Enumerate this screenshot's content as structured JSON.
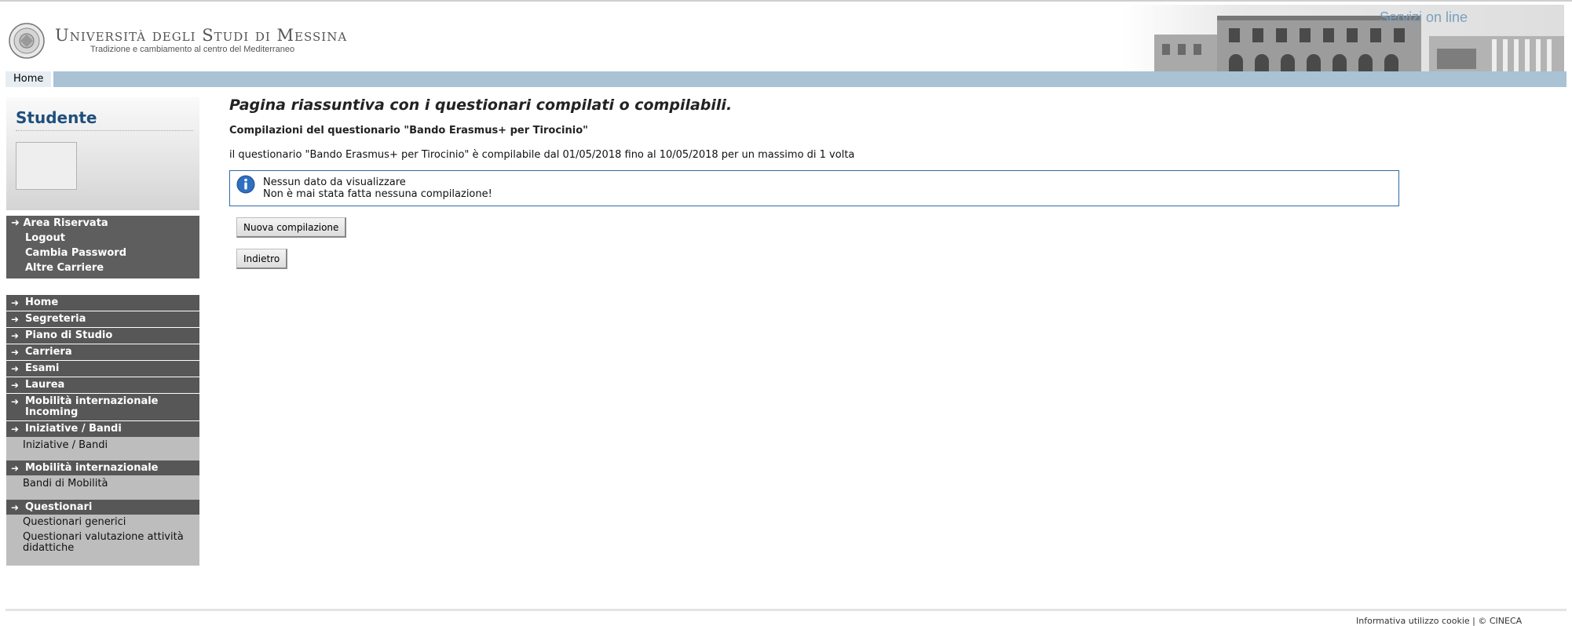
{
  "header": {
    "university_name": "Università degli Studi di Messina",
    "tagline": "Tradizione e cambiamento al centro del Mediterraneo",
    "services_label": "Servizi on line"
  },
  "navbar": {
    "home_label": "Home"
  },
  "sidebar": {
    "student_title": "Studente",
    "reserved": {
      "title": "Area Riservata",
      "items": [
        "Logout",
        "Cambia Password",
        "Altre Carriere"
      ]
    },
    "menu": [
      "Home",
      "Segreteria",
      "Piano di Studio",
      "Carriera",
      "Esami",
      "Laurea",
      "Mobilità internazionale Incoming",
      "Iniziative / Bandi",
      "Mobilità internazionale",
      "Questionari"
    ],
    "submenu": {
      "iniziative": [
        "Iniziative / Bandi"
      ],
      "mobilita": [
        "Bandi di Mobilità"
      ],
      "questionari": [
        "Questionari generici",
        "Questionari valutazione attività didattiche"
      ]
    }
  },
  "main": {
    "title": "Pagina riassuntiva con i questionari compilati o compilabili.",
    "subtitle": "Compilazioni del questionario \"Bando Erasmus+ per Tirocinio\"",
    "info": "il questionario \"Bando Erasmus+ per Tirocinio\"  è compilabile dal 01/05/2018 fino al 10/05/2018 per un massimo di 1 volta",
    "message_line1": "Nessun dato da visualizzare",
    "message_line2": "Non è mai stata fatta nessuna compilazione!",
    "new_button": "Nuova compilazione",
    "back_button": "Indietro"
  },
  "footer": {
    "cookie_link": "Informativa utilizzo cookie",
    "separator": "|",
    "copyright": "© CINECA"
  },
  "colors": {
    "navbar": "#a9c2d4",
    "sidebar_dark": "#575757",
    "sidebar_light": "#bdbdbd",
    "student_title": "#1f4f7d",
    "message_border": "#2f6aa3"
  }
}
